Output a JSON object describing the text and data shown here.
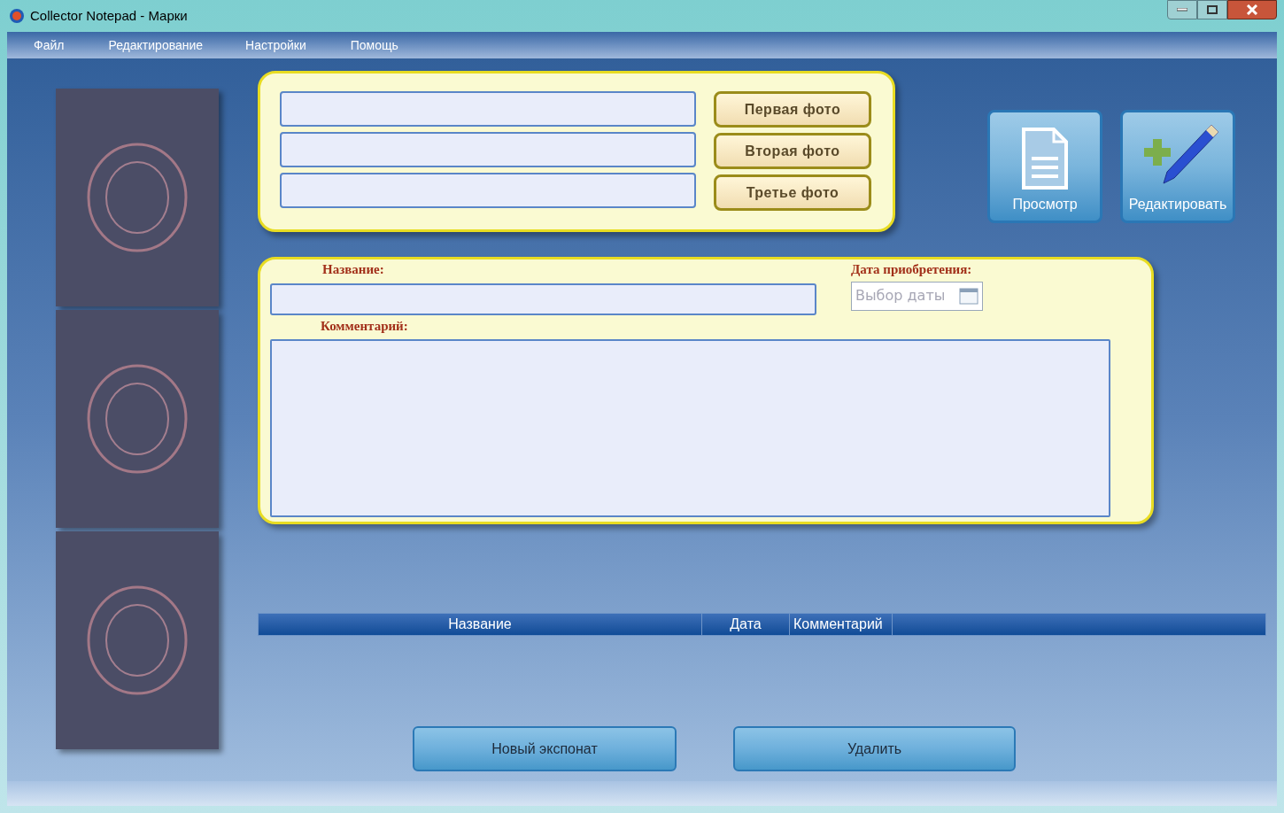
{
  "window": {
    "title": "Collector Notepad - Марки"
  },
  "menu": [
    "Файл",
    "Редактирование",
    "Настройки",
    "Помощь"
  ],
  "photo_buttons": [
    "Первая фото",
    "Вторая фото",
    "Третье фото"
  ],
  "tool_buttons": [
    {
      "kind": "view",
      "label": "Просмотр"
    },
    {
      "kind": "edit",
      "label": "Редактировать"
    }
  ],
  "form": {
    "name_label": "Название:",
    "date_label": "Дата приобретения:",
    "date_placeholder": "Выбор даты",
    "comment_label": "Комментарий:"
  },
  "table": {
    "columns": [
      "Название",
      "Дата",
      "Комментарий"
    ]
  },
  "buttons": [
    "Новый экспонат",
    "Удалить"
  ]
}
